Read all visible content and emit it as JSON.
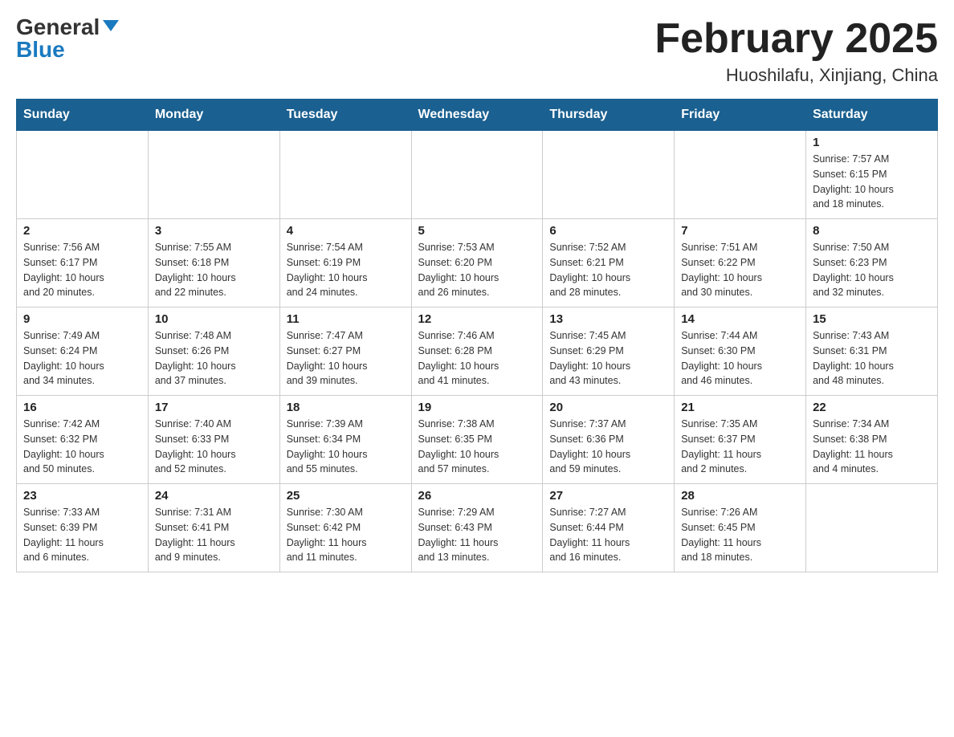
{
  "header": {
    "logo_general": "General",
    "logo_blue": "Blue",
    "title": "February 2025",
    "subtitle": "Huoshilafu, Xinjiang, China"
  },
  "days_of_week": [
    "Sunday",
    "Monday",
    "Tuesday",
    "Wednesday",
    "Thursday",
    "Friday",
    "Saturday"
  ],
  "weeks": [
    [
      {
        "day": "",
        "info": ""
      },
      {
        "day": "",
        "info": ""
      },
      {
        "day": "",
        "info": ""
      },
      {
        "day": "",
        "info": ""
      },
      {
        "day": "",
        "info": ""
      },
      {
        "day": "",
        "info": ""
      },
      {
        "day": "1",
        "info": "Sunrise: 7:57 AM\nSunset: 6:15 PM\nDaylight: 10 hours\nand 18 minutes."
      }
    ],
    [
      {
        "day": "2",
        "info": "Sunrise: 7:56 AM\nSunset: 6:17 PM\nDaylight: 10 hours\nand 20 minutes."
      },
      {
        "day": "3",
        "info": "Sunrise: 7:55 AM\nSunset: 6:18 PM\nDaylight: 10 hours\nand 22 minutes."
      },
      {
        "day": "4",
        "info": "Sunrise: 7:54 AM\nSunset: 6:19 PM\nDaylight: 10 hours\nand 24 minutes."
      },
      {
        "day": "5",
        "info": "Sunrise: 7:53 AM\nSunset: 6:20 PM\nDaylight: 10 hours\nand 26 minutes."
      },
      {
        "day": "6",
        "info": "Sunrise: 7:52 AM\nSunset: 6:21 PM\nDaylight: 10 hours\nand 28 minutes."
      },
      {
        "day": "7",
        "info": "Sunrise: 7:51 AM\nSunset: 6:22 PM\nDaylight: 10 hours\nand 30 minutes."
      },
      {
        "day": "8",
        "info": "Sunrise: 7:50 AM\nSunset: 6:23 PM\nDaylight: 10 hours\nand 32 minutes."
      }
    ],
    [
      {
        "day": "9",
        "info": "Sunrise: 7:49 AM\nSunset: 6:24 PM\nDaylight: 10 hours\nand 34 minutes."
      },
      {
        "day": "10",
        "info": "Sunrise: 7:48 AM\nSunset: 6:26 PM\nDaylight: 10 hours\nand 37 minutes."
      },
      {
        "day": "11",
        "info": "Sunrise: 7:47 AM\nSunset: 6:27 PM\nDaylight: 10 hours\nand 39 minutes."
      },
      {
        "day": "12",
        "info": "Sunrise: 7:46 AM\nSunset: 6:28 PM\nDaylight: 10 hours\nand 41 minutes."
      },
      {
        "day": "13",
        "info": "Sunrise: 7:45 AM\nSunset: 6:29 PM\nDaylight: 10 hours\nand 43 minutes."
      },
      {
        "day": "14",
        "info": "Sunrise: 7:44 AM\nSunset: 6:30 PM\nDaylight: 10 hours\nand 46 minutes."
      },
      {
        "day": "15",
        "info": "Sunrise: 7:43 AM\nSunset: 6:31 PM\nDaylight: 10 hours\nand 48 minutes."
      }
    ],
    [
      {
        "day": "16",
        "info": "Sunrise: 7:42 AM\nSunset: 6:32 PM\nDaylight: 10 hours\nand 50 minutes."
      },
      {
        "day": "17",
        "info": "Sunrise: 7:40 AM\nSunset: 6:33 PM\nDaylight: 10 hours\nand 52 minutes."
      },
      {
        "day": "18",
        "info": "Sunrise: 7:39 AM\nSunset: 6:34 PM\nDaylight: 10 hours\nand 55 minutes."
      },
      {
        "day": "19",
        "info": "Sunrise: 7:38 AM\nSunset: 6:35 PM\nDaylight: 10 hours\nand 57 minutes."
      },
      {
        "day": "20",
        "info": "Sunrise: 7:37 AM\nSunset: 6:36 PM\nDaylight: 10 hours\nand 59 minutes."
      },
      {
        "day": "21",
        "info": "Sunrise: 7:35 AM\nSunset: 6:37 PM\nDaylight: 11 hours\nand 2 minutes."
      },
      {
        "day": "22",
        "info": "Sunrise: 7:34 AM\nSunset: 6:38 PM\nDaylight: 11 hours\nand 4 minutes."
      }
    ],
    [
      {
        "day": "23",
        "info": "Sunrise: 7:33 AM\nSunset: 6:39 PM\nDaylight: 11 hours\nand 6 minutes."
      },
      {
        "day": "24",
        "info": "Sunrise: 7:31 AM\nSunset: 6:41 PM\nDaylight: 11 hours\nand 9 minutes."
      },
      {
        "day": "25",
        "info": "Sunrise: 7:30 AM\nSunset: 6:42 PM\nDaylight: 11 hours\nand 11 minutes."
      },
      {
        "day": "26",
        "info": "Sunrise: 7:29 AM\nSunset: 6:43 PM\nDaylight: 11 hours\nand 13 minutes."
      },
      {
        "day": "27",
        "info": "Sunrise: 7:27 AM\nSunset: 6:44 PM\nDaylight: 11 hours\nand 16 minutes."
      },
      {
        "day": "28",
        "info": "Sunrise: 7:26 AM\nSunset: 6:45 PM\nDaylight: 11 hours\nand 18 minutes."
      },
      {
        "day": "",
        "info": ""
      }
    ]
  ]
}
